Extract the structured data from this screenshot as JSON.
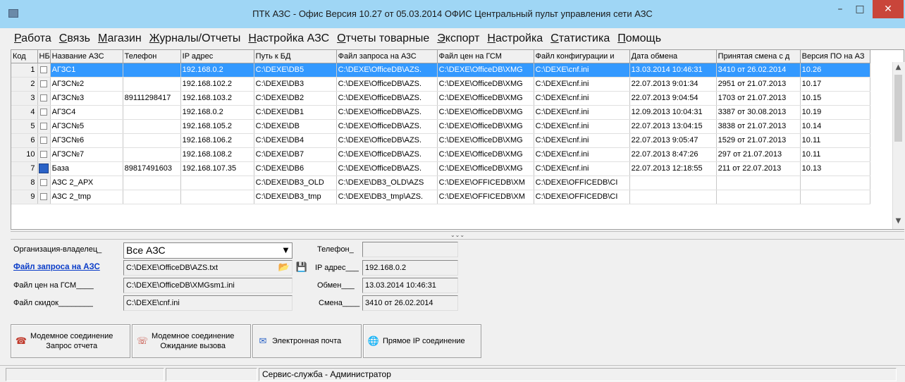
{
  "window": {
    "title": "ПТК АЗС - Офис Версия 10.27 от 05.03.2014 ОФИС Центральный пульт управления сети АЗС",
    "min_symbol": "–",
    "max_symbol": "□",
    "close_symbol": "✕"
  },
  "menu": [
    "Работа",
    "Связь",
    "Магазин",
    "Журналы/Отчеты",
    "Настройка АЗС",
    "Отчеты товарные",
    "Экспорт",
    "Настройка",
    "Статистика",
    "Помощь"
  ],
  "grid": {
    "columns": [
      "Код",
      "НБ",
      "Название АЗС",
      "Телефон",
      "IP адрес",
      "Путь к БД",
      "Файл запроса на АЗС",
      "Файл цен на ГСМ",
      "Файл конфигурации и",
      "Дата обмена",
      "Принятая смена с д",
      "Версия ПО на АЗ"
    ],
    "rows": [
      {
        "code": "1",
        "name": "АГЗС1",
        "phone": "",
        "ip": "192.168.0.2",
        "db": "C:\\DEXE\\DB5",
        "req": "C:\\DEXE\\OfficeDB\\AZS.",
        "price": "C:\\DEXE\\OfficeDB\\XMG",
        "cfg": "C:\\DEXE\\cnf.ini",
        "date": "13.03.2014 10:46:31",
        "shift": "3410 от 26.02.2014",
        "ver": "10.26",
        "selected": true
      },
      {
        "code": "2",
        "name": "АГЗС№2",
        "phone": "",
        "ip": "192.168.102.2",
        "db": "C:\\DEXE\\DB3",
        "req": "C:\\DEXE\\OfficeDB\\AZS.",
        "price": "C:\\DEXE\\OfficeDB\\XMG",
        "cfg": "C:\\DEXE\\cnf.ini",
        "date": "22.07.2013 9:01:34",
        "shift": "2951 от 21.07.2013",
        "ver": "10.17"
      },
      {
        "code": "3",
        "name": "АГЗС№3",
        "phone": "89111298417",
        "ip": "192.168.103.2",
        "db": "C:\\DEXE\\DB2",
        "req": "C:\\DEXE\\OfficeDB\\AZS.",
        "price": "C:\\DEXE\\OfficeDB\\XMG",
        "cfg": "C:\\DEXE\\cnf.ini",
        "date": "22.07.2013 9:04:54",
        "shift": "1703 от 21.07.2013",
        "ver": "10.15"
      },
      {
        "code": "4",
        "name": "АГЗС4",
        "phone": "",
        "ip": "192.168.0.2",
        "db": "C:\\DEXE\\DB1",
        "req": "C:\\DEXE\\OfficeDB\\AZS.",
        "price": "C:\\DEXE\\OfficeDB\\XMG",
        "cfg": "C:\\DEXE\\cnf.ini",
        "date": "12.09.2013 10:04:31",
        "shift": "3387 от 30.08.2013",
        "ver": "10.19"
      },
      {
        "code": "5",
        "name": "АГЗС№5",
        "phone": "",
        "ip": "192.168.105.2",
        "db": "C:\\DEXE\\DB",
        "req": "C:\\DEXE\\OfficeDB\\AZS.",
        "price": "C:\\DEXE\\OfficeDB\\XMG",
        "cfg": "C:\\DEXE\\cnf.ini",
        "date": "22.07.2013 13:04:15",
        "shift": "3838 от 21.07.2013",
        "ver": "10.14"
      },
      {
        "code": "6",
        "name": "АГЗС№6",
        "phone": "",
        "ip": "192.168.106.2",
        "db": "C:\\DEXE\\DB4",
        "req": "C:\\DEXE\\OfficeDB\\AZS.",
        "price": "C:\\DEXE\\OfficeDB\\XMG",
        "cfg": "C:\\DEXE\\cnf.ini",
        "date": "22.07.2013 9:05:47",
        "shift": "1529 от 21.07.2013",
        "ver": "10.11"
      },
      {
        "code": "10",
        "name": "АГЗС№7",
        "phone": "",
        "ip": "192.168.108.2",
        "db": "C:\\DEXE\\DB7",
        "req": "C:\\DEXE\\OfficeDB\\AZS.",
        "price": "C:\\DEXE\\OfficeDB\\XMG",
        "cfg": "C:\\DEXE\\cnf.ini",
        "date": "22.07.2013 8:47:26",
        "shift": "297 от 21.07.2013",
        "ver": "10.11"
      },
      {
        "code": "7",
        "name": "База",
        "phone": "89817491603",
        "ip": "192.168.107.35",
        "db": "C:\\DEXE\\DB6",
        "req": "C:\\DEXE\\OfficeDB\\AZS.",
        "price": "C:\\DEXE\\OfficeDB\\XMG",
        "cfg": "C:\\DEXE\\cnf.ini",
        "date": "22.07.2013 12:18:55",
        "shift": "211 от 22.07.2013",
        "ver": "10.13",
        "big_icon": true
      },
      {
        "code": "8",
        "name": "АЗС 2_АРХ",
        "phone": "",
        "ip": "",
        "db": "C:\\DEXE\\DB3_OLD",
        "req": "C:\\DEXE\\DB3_OLD\\AZS",
        "price": "C:\\DEXE\\OFFICEDB\\XM",
        "cfg": "C:\\DEXE\\OFFICEDB\\CI",
        "date": "",
        "shift": "",
        "ver": ""
      },
      {
        "code": "9",
        "name": "АЗС 2_tmp",
        "phone": "",
        "ip": "",
        "db": "C:\\DEXE\\DB3_tmp",
        "req": "C:\\DEXE\\DB3_tmp\\AZS.",
        "price": "C:\\DEXE\\OFFICEDB\\XM",
        "cfg": "C:\\DEXE\\OFFICEDB\\CI",
        "date": "",
        "shift": "",
        "ver": ""
      }
    ]
  },
  "details": {
    "owner_label": "Организация-владелец_",
    "owner_value": "Все АЗС",
    "req_file_label": "Файл запроса на АЗС",
    "req_file_value": "C:\\DEXE\\OfficeDB\\AZS.txt",
    "price_file_label": "Файл цен на ГСМ____",
    "price_file_value": "C:\\DEXE\\OfficeDB\\XMGsm1.ini",
    "discount_file_label": "Файл скидок________",
    "discount_file_value": "C:\\DEXE\\cnf.ini",
    "phone_label": "Телефон_",
    "phone_value": "",
    "ip_label": "IP адрес___",
    "ip_value": "192.168.0.2",
    "exchange_label": "Обмен___",
    "exchange_value": "13.03.2014 10:46:31",
    "shift_label": "Смена____",
    "shift_value": "3410 от 26.02.2014"
  },
  "buttons": {
    "modem_request_l1": "Модемное соединение",
    "modem_request_l2": "Запрос отчета",
    "modem_wait_l1": "Модемное соединение",
    "modem_wait_l2": "Ожидание вызова",
    "email": "Электронная почта",
    "direct_ip": "Прямое IP соединение"
  },
  "status": {
    "user": "Сервис-служба - Администратор"
  },
  "colors": {
    "selection": "#3399ff",
    "titlebar": "#9fd6f5",
    "close": "#c9453a",
    "link": "#0a3cc8"
  }
}
